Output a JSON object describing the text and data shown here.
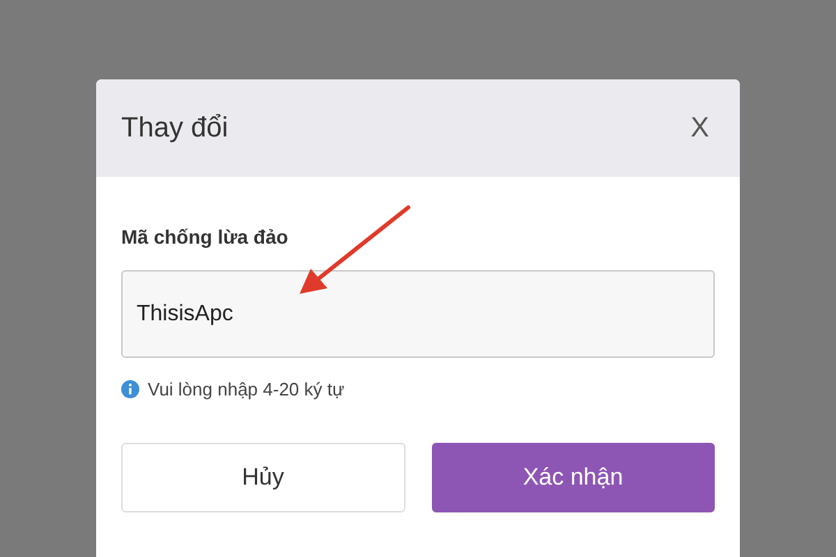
{
  "dialog": {
    "title": "Thay đổi",
    "close": "X"
  },
  "field": {
    "label": "Mã chống lừa đảo",
    "value": "ThisisApc",
    "hint": "Vui lòng nhập 4-20 ký tự"
  },
  "buttons": [
    {
      "label": "Hủy",
      "kind": "secondary"
    },
    {
      "label": "Xác nhận",
      "kind": "primary"
    }
  ]
}
